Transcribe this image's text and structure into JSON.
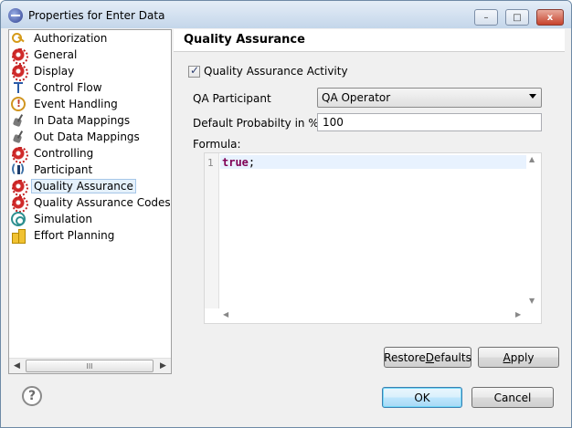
{
  "window": {
    "title": "Properties for Enter Data",
    "minimize": "–",
    "maximize": "□",
    "close": "x"
  },
  "tree": {
    "items": [
      {
        "label": "Authorization",
        "icon": "key-icon"
      },
      {
        "label": "General",
        "icon": "gear-icon"
      },
      {
        "label": "Display",
        "icon": "gear-icon"
      },
      {
        "label": "Control Flow",
        "icon": "flow-icon"
      },
      {
        "label": "Event Handling",
        "icon": "alert-icon"
      },
      {
        "label": "In Data Mappings",
        "icon": "mapping-icon"
      },
      {
        "label": "Out Data Mappings",
        "icon": "mapping-icon"
      },
      {
        "label": "Controlling",
        "icon": "gear-icon"
      },
      {
        "label": "Participant",
        "icon": "participant-icon"
      },
      {
        "label": "Quality Assurance",
        "icon": "gear-icon",
        "selected": true
      },
      {
        "label": "Quality Assurance Codes",
        "icon": "gear-icon"
      },
      {
        "label": "Simulation",
        "icon": "spiral-icon"
      },
      {
        "label": "Effort Planning",
        "icon": "effort-icon"
      }
    ],
    "scroll_thumb": "III",
    "scroll_left": "◀",
    "scroll_right": "▶"
  },
  "page": {
    "title": "Quality Assurance",
    "qa_activity_label": "Quality Assurance Activity",
    "qa_activity_checked": true,
    "participant_label": "QA Participant",
    "participant_value": "QA Operator",
    "probability_label": "Default Probabilty in %",
    "probability_value": "100",
    "formula_label": "Formula:",
    "formula_line_no": "1",
    "formula_code": "true",
    "formula_suffix": ";"
  },
  "buttons": {
    "restore_defaults_pre": "Restore ",
    "restore_defaults_u": "D",
    "restore_defaults_post": "efaults",
    "apply_u": "A",
    "apply_post": "pply",
    "ok": "OK",
    "cancel": "Cancel",
    "help": "?"
  }
}
